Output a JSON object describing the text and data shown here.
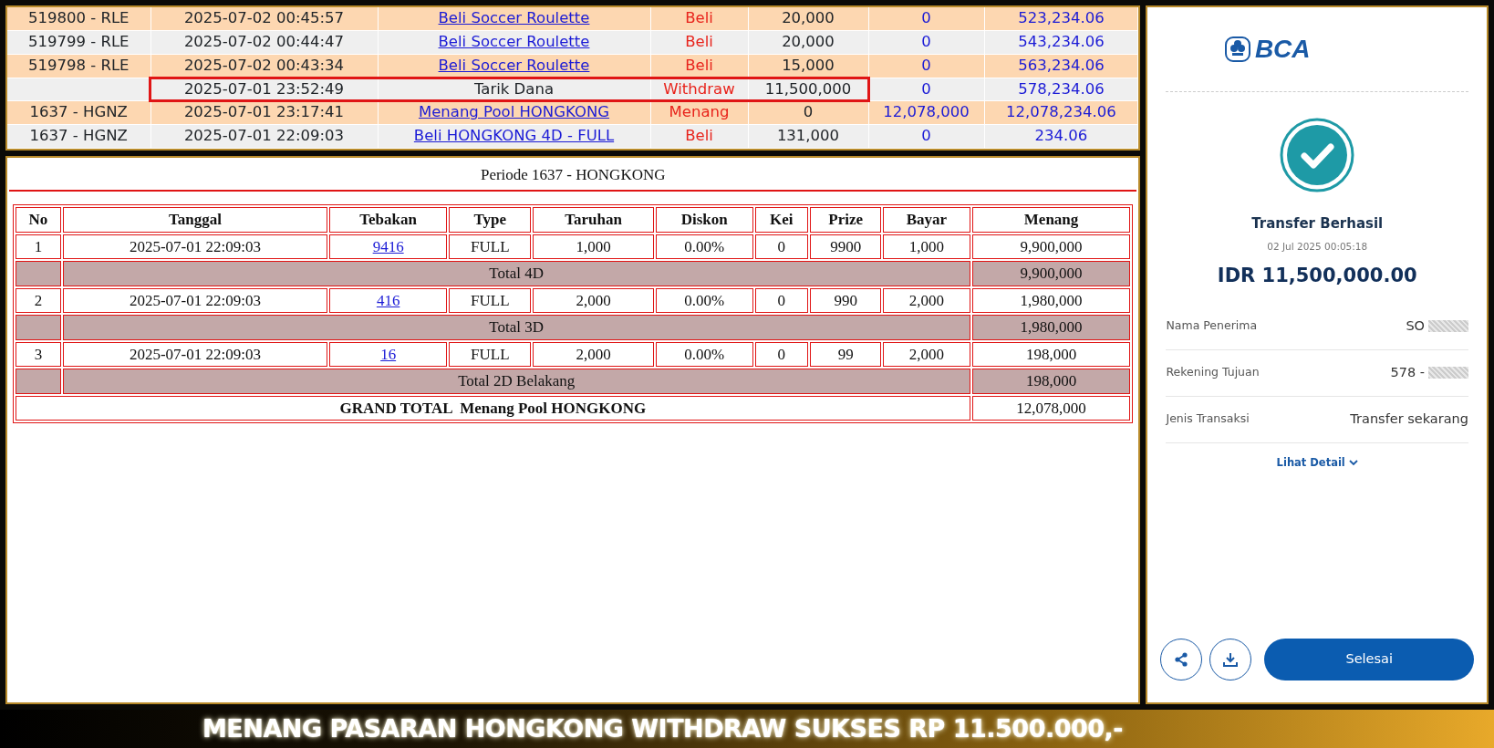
{
  "transactions": {
    "rows": [
      {
        "id": "519800 - RLE",
        "time": "2025-07-02 00:45:57",
        "description": "Beli Soccer Roulette",
        "linked": true,
        "type": "Beli",
        "debit": "20,000",
        "credit": "0",
        "balance": "523,234.06",
        "highlighted": false
      },
      {
        "id": "519799 - RLE",
        "time": "2025-07-02 00:44:47",
        "description": "Beli Soccer Roulette",
        "linked": true,
        "type": "Beli",
        "debit": "20,000",
        "credit": "0",
        "balance": "543,234.06",
        "highlighted": false
      },
      {
        "id": "519798 - RLE",
        "time": "2025-07-02 00:43:34",
        "description": "Beli Soccer Roulette",
        "linked": true,
        "type": "Beli",
        "debit": "15,000",
        "credit": "0",
        "balance": "563,234.06",
        "highlighted": false
      },
      {
        "time": "2025-07-01 23:52:49",
        "description": "Tarik Dana",
        "linked": false,
        "type": "Withdraw",
        "debit": "11,500,000",
        "credit": "0",
        "balance": "578,234.06",
        "highlighted": true
      },
      {
        "id": "1637 - HGNZ",
        "time": "2025-07-01 23:17:41",
        "description": "Menang Pool HONGKONG",
        "linked": true,
        "type": "Menang",
        "debit": "0",
        "credit": "12,078,000",
        "balance": "12,078,234.06",
        "highlighted": false
      },
      {
        "id": "1637 - HGNZ",
        "time": "2025-07-01 22:09:03",
        "description": "Beli HONGKONG 4D - FULL",
        "linked": true,
        "type": "Beli",
        "debit": "131,000",
        "credit": "0",
        "balance": "234.06",
        "highlighted": false
      }
    ]
  },
  "period_detail": {
    "title": "Periode 1637 - HONGKONG",
    "columns": [
      "No",
      "Tanggal",
      "Tebakan",
      "Type",
      "Taruhan",
      "Diskon",
      "Kei",
      "Prize",
      "Bayar",
      "Menang"
    ],
    "rows": [
      {
        "kind": "bet",
        "cells": [
          "1",
          "2025-07-01 22:09:03",
          "9416",
          "FULL",
          "1,000",
          "0.00%",
          "0",
          "9900",
          "1,000",
          "9,900,000"
        ]
      },
      {
        "kind": "subtotal",
        "label": "Total 4D",
        "value": "9,900,000"
      },
      {
        "kind": "bet",
        "cells": [
          "2",
          "2025-07-01 22:09:03",
          "416",
          "FULL",
          "2,000",
          "0.00%",
          "0",
          "990",
          "2,000",
          "1,980,000"
        ]
      },
      {
        "kind": "subtotal",
        "label": "Total 3D",
        "value": "1,980,000"
      },
      {
        "kind": "bet",
        "cells": [
          "3",
          "2025-07-01 22:09:03",
          "16",
          "FULL",
          "2,000",
          "0.00%",
          "0",
          "99",
          "2,000",
          "198,000"
        ]
      },
      {
        "kind": "subtotal",
        "label": "Total 2D Belakang",
        "value": "198,000"
      },
      {
        "kind": "grand_total",
        "label": "GRAND TOTAL  Menang Pool HONGKONG",
        "value": "12,078,000"
      }
    ]
  },
  "receipt": {
    "logo": "BCA",
    "status": "Transfer Berhasil",
    "datetime": "02 Jul 2025 00:05:18",
    "amount": "IDR 11,500,000.00",
    "details": [
      {
        "label": "Nama Penerima",
        "value": "SO",
        "masked": true
      },
      {
        "label": "Rekening Tujuan",
        "value": "578 -",
        "masked": true
      },
      {
        "label": "Jenis Transaksi",
        "value": "Transfer sekarang",
        "masked": false
      }
    ],
    "detail_link": "Lihat Detail",
    "done_button": "Selesai"
  },
  "banner": "MENANG PASARAN HONGKONG WITHDRAW SUKSES RP 11.500.000,-"
}
